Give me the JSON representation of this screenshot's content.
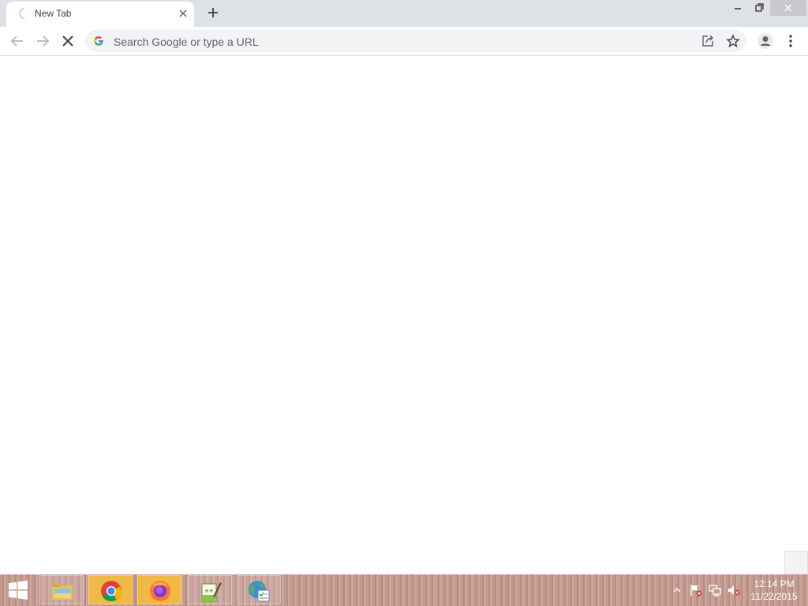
{
  "tab": {
    "title": "New Tab"
  },
  "omnibox": {
    "placeholder": "Search Google or type a URL"
  },
  "taskbar": {
    "apps": [
      {
        "name": "File Explorer"
      },
      {
        "name": "Google Chrome"
      },
      {
        "name": "Firefox"
      },
      {
        "name": "Notepad++"
      },
      {
        "name": "Globe checklist app"
      }
    ],
    "clock": {
      "time": "12:14 PM",
      "date": "11/22/2015"
    }
  },
  "colors": {
    "tabstrip": "#dee1e6",
    "toolbar": "#ffffff",
    "omnibox": "#f1f3f4",
    "taskbar": "#c39a90",
    "active_app": "#f0b846"
  }
}
